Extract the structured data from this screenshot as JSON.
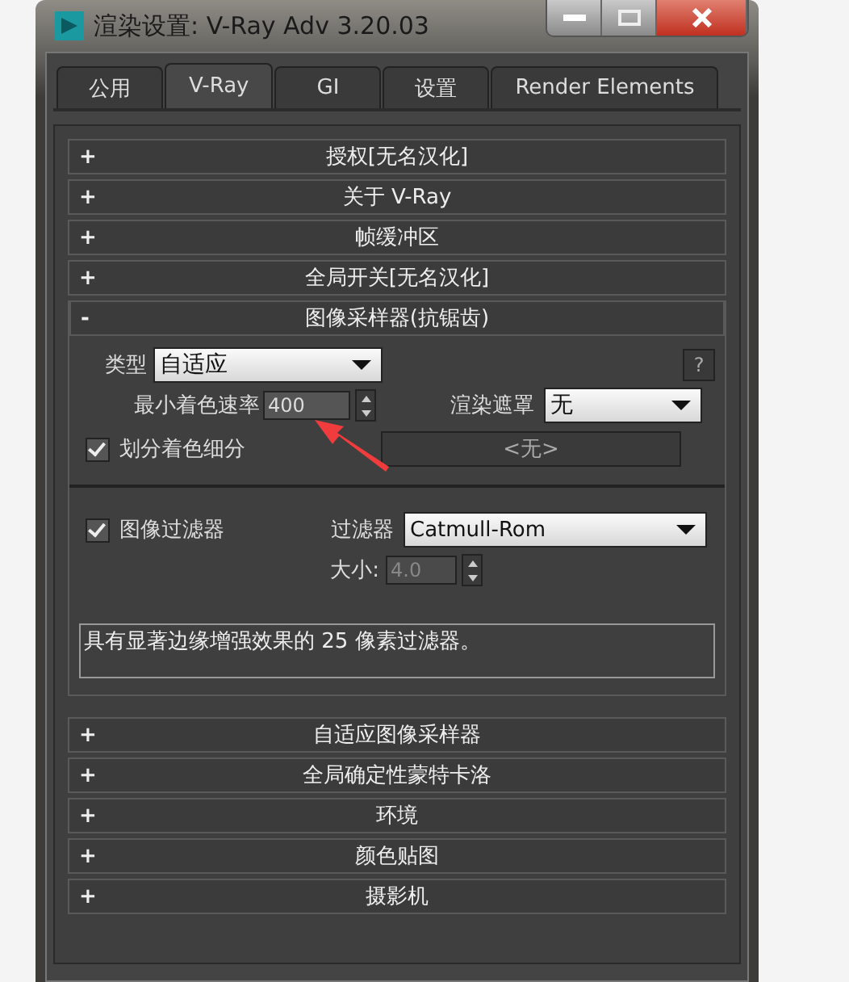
{
  "window": {
    "title": "渲染设置: V-Ray Adv 3.20.03"
  },
  "tabs": [
    {
      "label": "公用",
      "selected": false
    },
    {
      "label": "V-Ray",
      "selected": true
    },
    {
      "label": "GI",
      "selected": false
    },
    {
      "label": "设置",
      "selected": false
    },
    {
      "label": "Render Elements",
      "selected": false
    }
  ],
  "rollouts_top": [
    {
      "sign": "+",
      "title": "授权[无名汉化]"
    },
    {
      "sign": "+",
      "title": "关于 V-Ray"
    },
    {
      "sign": "+",
      "title": "帧缓冲区"
    },
    {
      "sign": "+",
      "title": "全局开关[无名汉化]"
    }
  ],
  "image_sampler": {
    "sign": "-",
    "title": "图像采样器(抗锯齿)",
    "type_label": "类型",
    "type_value": "自适应",
    "help": "?",
    "min_rate_label": "最小着色速率",
    "min_rate_value": "400",
    "mask_label": "渲染遮罩",
    "mask_value": "无",
    "mask_button": "<无>",
    "subdivs": {
      "label": "划分着色细分",
      "checked": true
    },
    "filter": {
      "label": "图像过滤器",
      "checked": true
    },
    "filter_label": "过滤器",
    "filter_value": "Catmull-Rom",
    "size_label": "大小:",
    "size_value": "4.0",
    "size_disabled": true,
    "description": "具有显著边缘增强效果的 25 像素过滤器。"
  },
  "rollouts_bottom": [
    {
      "sign": "+",
      "title": "自适应图像采样器"
    },
    {
      "sign": "+",
      "title": "全局确定性蒙特卡洛"
    },
    {
      "sign": "+",
      "title": "环境"
    },
    {
      "sign": "+",
      "title": "颜色贴图"
    },
    {
      "sign": "+",
      "title": "摄影机"
    }
  ]
}
